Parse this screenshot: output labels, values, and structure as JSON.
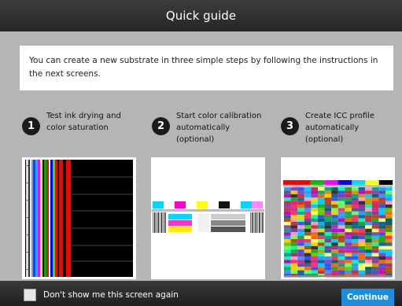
{
  "title": "Quick guide",
  "intro_text": "You can create a new substrate in three simple steps by following the instructions in the next screens.",
  "steps": [
    {
      "number": "1",
      "lines": [
        "Test ink drying and",
        "color saturation"
      ]
    },
    {
      "number": "2",
      "lines": [
        "Start color calibration",
        "automatically",
        "(optional)"
      ]
    },
    {
      "number": "3",
      "lines": [
        "Create ICC profile",
        "automatically",
        "(optional)"
      ]
    }
  ],
  "footer": {
    "checkbox_label": "Don't show me this screen again",
    "continue_label": "Continue"
  },
  "colors": {
    "accent": "#1a8ee0",
    "titlebar": "#2f2f2f",
    "background": "#b5b5b5"
  }
}
